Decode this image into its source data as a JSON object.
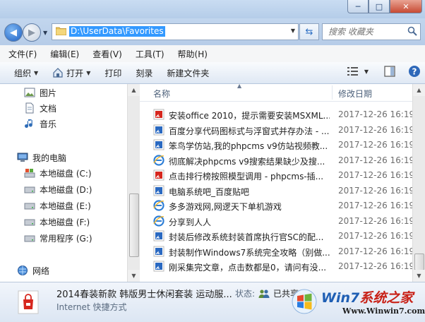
{
  "window": {
    "minimize_glyph": "─",
    "maximize_glyph": "□",
    "close_glyph": "✕"
  },
  "address": {
    "path": "D:\\UserData\\Favorites",
    "search_placeholder": "搜索 收藏夹"
  },
  "menu": [
    "文件(F)",
    "编辑(E)",
    "查看(V)",
    "工具(T)",
    "帮助(H)"
  ],
  "toolbar": {
    "organize": "组织",
    "open": "打开",
    "print": "打印",
    "burn": "刻录",
    "new_folder": "新建文件夹"
  },
  "nav": {
    "pictures": "图片",
    "documents": "文档",
    "music": "音乐",
    "computer": "我的电脑",
    "drive_c": "本地磁盘 (C:)",
    "drive_d": "本地磁盘 (D:)",
    "drive_e": "本地磁盘 (E:)",
    "drive_f": "本地磁盘 (F:)",
    "drive_g": "常用程序 (G:)",
    "network": "网络"
  },
  "columns": {
    "name": "名称",
    "date": "修改日期"
  },
  "files": [
    {
      "name": "安装office 2010，提示需要安装MSXML...",
      "date": "2017-12-26 16:19",
      "icon": "red-shortcut-icon"
    },
    {
      "name": "百度分享代码图标式与浮窗式并存办法 - ...",
      "date": "2017-12-26 16:19",
      "icon": "blue-shortcut-icon"
    },
    {
      "name": "笨鸟学仿站,我的phpcms v9仿站视频教...",
      "date": "2017-12-26 16:19",
      "icon": "blue-shortcut-icon"
    },
    {
      "name": "彻底解决phpcms v9搜索结果缺少及搜...",
      "date": "2017-12-26 16:19",
      "icon": "ie-icon"
    },
    {
      "name": "点击排行榜按照模型调用 - phpcms-插...",
      "date": "2017-12-26 16:19",
      "icon": "red-shortcut-icon"
    },
    {
      "name": "电脑系统吧_百度贴吧",
      "date": "2017-12-26 16:19",
      "icon": "blue-shortcut-icon"
    },
    {
      "name": "多多游戏网,网逻天下单机游戏",
      "date": "2017-12-26 16:19",
      "icon": "ie-icon"
    },
    {
      "name": "分享到人人",
      "date": "2017-12-26 16:19",
      "icon": "ie-icon"
    },
    {
      "name": "封装后修改系统封装首席执行官SC的配...",
      "date": "2017-12-26 16:19",
      "icon": "blue-shortcut-icon"
    },
    {
      "name": "封装制作Windows7系统完全攻略（别做...",
      "date": "2017-12-26 16:19",
      "icon": "blue-shortcut-icon"
    },
    {
      "name": "刚采集完文章，点击数都是0，请问有没...",
      "date": "2017-12-26 16:19",
      "icon": "blue-shortcut-icon"
    }
  ],
  "details": {
    "title": "2014春装新款 韩版男士休闲套装 运动服...",
    "type": "Internet 快捷方式",
    "status_label": "状态:",
    "status_value": "已共享"
  },
  "watermark": {
    "brand_a": "Win7",
    "brand_b": "系统之家",
    "url": "Www.Winwin7.com"
  }
}
